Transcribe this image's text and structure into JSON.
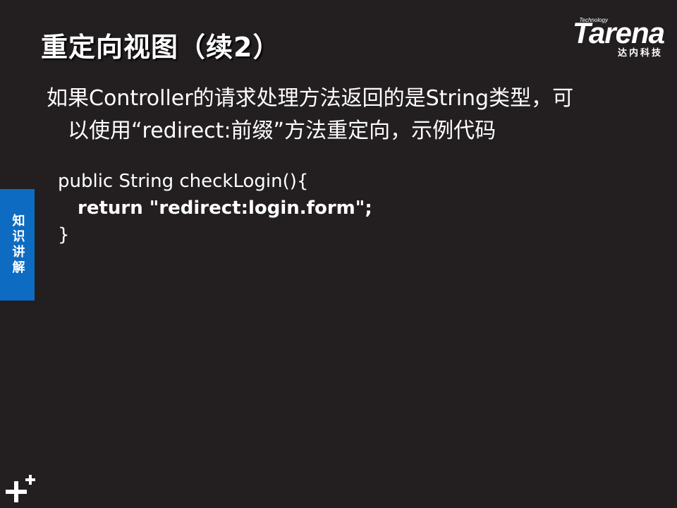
{
  "slide": {
    "title": "重定向视图（续2）",
    "body_lines": [
      "如果Controller的请求处理方法返回的是String类型，可",
      "以使用“redirect:前缀”方法重定向，示例代码"
    ],
    "code_lines": [
      "public String checkLogin(){",
      "return \"redirect:login.form\";",
      "}"
    ],
    "side_tab_label": "知识讲解"
  },
  "logo": {
    "small_text": "Technology",
    "wordmark": "Tarena",
    "chinese": "达内科技"
  },
  "colors": {
    "background": "#231f20",
    "side_tab": "#0e6bc2",
    "text": "#ffffff"
  },
  "icons": {
    "corner": "plus-icon"
  }
}
